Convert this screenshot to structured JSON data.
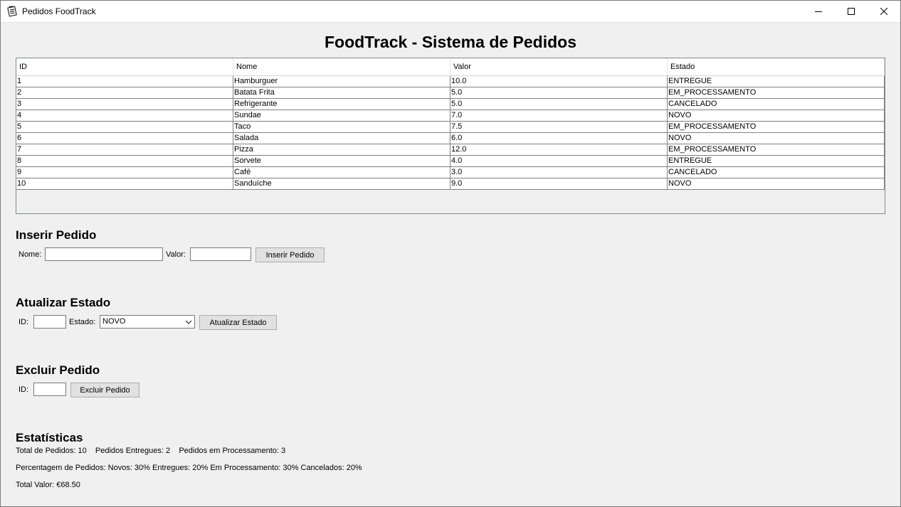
{
  "window": {
    "title": "Pedidos FoodTrack"
  },
  "heading": "FoodTrack - Sistema de Pedidos",
  "table": {
    "columns": [
      "ID",
      "Nome",
      "Valor",
      "Estado"
    ],
    "rows": [
      [
        "1",
        "Hamburguer",
        "10.0",
        "ENTREGUE"
      ],
      [
        "2",
        "Batata Frita",
        "5.0",
        "EM_PROCESSAMENTO"
      ],
      [
        "3",
        "Refrigerante",
        "5.0",
        "CANCELADO"
      ],
      [
        "4",
        "Sundae",
        "7.0",
        "NOVO"
      ],
      [
        "5",
        "Taco",
        "7.5",
        "EM_PROCESSAMENTO"
      ],
      [
        "6",
        "Salada",
        "6.0",
        "NOVO"
      ],
      [
        "7",
        "Pizza",
        "12.0",
        "EM_PROCESSAMENTO"
      ],
      [
        "8",
        "Sorvete",
        "4.0",
        "ENTREGUE"
      ],
      [
        "9",
        "Café",
        "3.0",
        "CANCELADO"
      ],
      [
        "10",
        "Sanduíche",
        "9.0",
        "NOVO"
      ]
    ]
  },
  "insert": {
    "title": "Inserir Pedido",
    "nome_label": "Nome:",
    "nome_value": "",
    "valor_label": "Valor:",
    "valor_value": "",
    "button": "Inserir Pedido"
  },
  "update": {
    "title": "Atualizar Estado",
    "id_label": "ID:",
    "id_value": "",
    "estado_label": "Estado:",
    "estado_selected": "NOVO",
    "button": "Atualizar Estado"
  },
  "delete": {
    "title": "Excluir Pedido",
    "id_label": "ID:",
    "id_value": "",
    "button": "Excluir Pedido"
  },
  "stats": {
    "title": "Estatísticas",
    "line1": "Total de Pedidos: 10    Pedidos Entregues: 2    Pedidos em Processamento: 3",
    "line2": "Percentagem de Pedidos: Novos: 30% Entregues: 20% Em Processamento: 30% Cancelados: 20%",
    "line3": "Total Valor: €68.50"
  }
}
